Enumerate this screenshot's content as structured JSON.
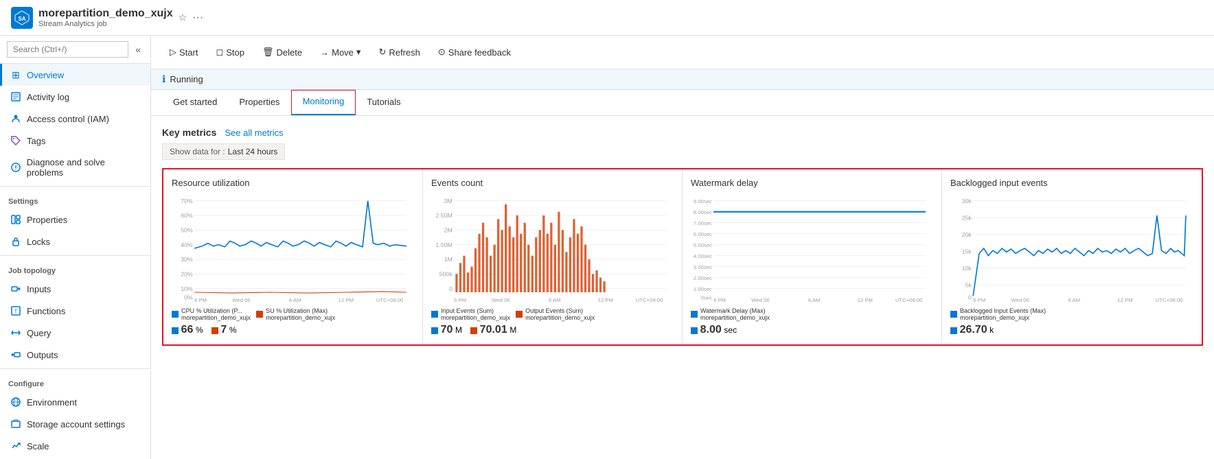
{
  "header": {
    "app_name": "morepartition_demo_xujx",
    "subtitle": "Stream Analytics job",
    "icon_letter": "SA"
  },
  "toolbar": {
    "start_label": "Start",
    "stop_label": "Stop",
    "delete_label": "Delete",
    "move_label": "Move",
    "refresh_label": "Refresh",
    "share_feedback_label": "Share feedback"
  },
  "status": {
    "text": "Running"
  },
  "tabs": [
    {
      "id": "get-started",
      "label": "Get started",
      "active": false
    },
    {
      "id": "properties",
      "label": "Properties",
      "active": false
    },
    {
      "id": "monitoring",
      "label": "Monitoring",
      "active": true
    },
    {
      "id": "tutorials",
      "label": "Tutorials",
      "active": false
    }
  ],
  "sidebar": {
    "search_placeholder": "Search (Ctrl+/)",
    "items": [
      {
        "id": "overview",
        "label": "Overview",
        "active": true,
        "icon": "⊞"
      },
      {
        "id": "activity-log",
        "label": "Activity log",
        "active": false,
        "icon": "☰"
      },
      {
        "id": "access-control",
        "label": "Access control (IAM)",
        "active": false,
        "icon": "👤"
      },
      {
        "id": "tags",
        "label": "Tags",
        "active": false,
        "icon": "🏷"
      },
      {
        "id": "diagnose",
        "label": "Diagnose and solve problems",
        "active": false,
        "icon": "⚕"
      }
    ],
    "sections": [
      {
        "label": "Settings",
        "items": [
          {
            "id": "properties",
            "label": "Properties",
            "icon": "⊟"
          },
          {
            "id": "locks",
            "label": "Locks",
            "icon": "🔒"
          }
        ]
      },
      {
        "label": "Job topology",
        "items": [
          {
            "id": "inputs",
            "label": "Inputs",
            "icon": "→"
          },
          {
            "id": "functions",
            "label": "Functions",
            "icon": "⚡"
          },
          {
            "id": "query",
            "label": "Query",
            "icon": "⟺"
          },
          {
            "id": "outputs",
            "label": "Outputs",
            "icon": "⊳"
          }
        ]
      },
      {
        "label": "Configure",
        "items": [
          {
            "id": "environment",
            "label": "Environment",
            "icon": "🌐"
          },
          {
            "id": "storage-account-settings",
            "label": "Storage account settings",
            "icon": "💾"
          },
          {
            "id": "scale",
            "label": "Scale",
            "icon": "✏"
          }
        ]
      }
    ]
  },
  "metrics": {
    "title": "Key metrics",
    "link_label": "See all metrics",
    "data_range_label": "Show data for :",
    "data_range_value": "Last 24 hours"
  },
  "charts": [
    {
      "id": "resource-utilization",
      "title": "Resource utilization",
      "y_labels": [
        "70%",
        "60%",
        "50%",
        "40%",
        "30%",
        "20%",
        "10%",
        "0%"
      ],
      "x_labels": [
        "6 PM",
        "Wed 06",
        "6 AM",
        "12 PM",
        "UTC+08:00"
      ],
      "legend": [
        {
          "color": "#0078d4",
          "label": "CPU % Utilization (P...",
          "sublabel": "morepartition_demo_xujx"
        },
        {
          "color": "#d83b01",
          "label": "SU % Utilization (Max)",
          "sublabel": "morepartition_demo_xujx"
        }
      ],
      "value1": "66",
      "value1_unit": "%",
      "value2": "7",
      "value2_unit": "%",
      "chart_color1": "#0078d4",
      "chart_color2": "#d83b01"
    },
    {
      "id": "events-count",
      "title": "Events count",
      "y_labels": [
        "3M",
        "2.50M",
        "2M",
        "1.50M",
        "1M",
        "500k",
        "0"
      ],
      "x_labels": [
        "6 PM",
        "Wed 06",
        "6 AM",
        "12 PM",
        "UTC+08:00"
      ],
      "legend": [
        {
          "color": "#0078d4",
          "label": "Input Events (Sum)",
          "sublabel": "morepartition_demo_xujx"
        },
        {
          "color": "#d83b01",
          "label": "Output Events (Sum)",
          "sublabel": "morepartition_demo_xujx"
        }
      ],
      "value1": "70",
      "value1_unit": "M",
      "value2": "70.01",
      "value2_unit": "M",
      "chart_color1": "#0078d4",
      "chart_color2": "#d83b01"
    },
    {
      "id": "watermark-delay",
      "title": "Watermark delay",
      "y_labels": [
        "9.00sec",
        "8.00sec",
        "7.00sec",
        "6.00sec",
        "5.00sec",
        "4.00sec",
        "3.00sec",
        "2.00sec",
        "1.00sec",
        "0sec"
      ],
      "x_labels": [
        "6 PM",
        "Wed 06",
        "6 AM",
        "12 PM",
        "UTC+08:00"
      ],
      "legend": [
        {
          "color": "#0078d4",
          "label": "Watermark Delay (Max)",
          "sublabel": "morepartition_demo_xujx"
        }
      ],
      "value1": "8.00",
      "value1_unit": "sec",
      "chart_color1": "#0078d4"
    },
    {
      "id": "backlogged-input-events",
      "title": "Backlogged input events",
      "y_labels": [
        "30k",
        "25k",
        "20k",
        "15k",
        "10k",
        "5k",
        "0"
      ],
      "x_labels": [
        "6 PM",
        "Wed 06",
        "6 AM",
        "12 PM",
        "UTC+08:00"
      ],
      "legend": [
        {
          "color": "#0078d4",
          "label": "Backlogged Input Events (Max)",
          "sublabel": "morepartition_demo_xujx"
        }
      ],
      "value1": "26.70",
      "value1_unit": "k",
      "chart_color1": "#0078d4"
    }
  ]
}
